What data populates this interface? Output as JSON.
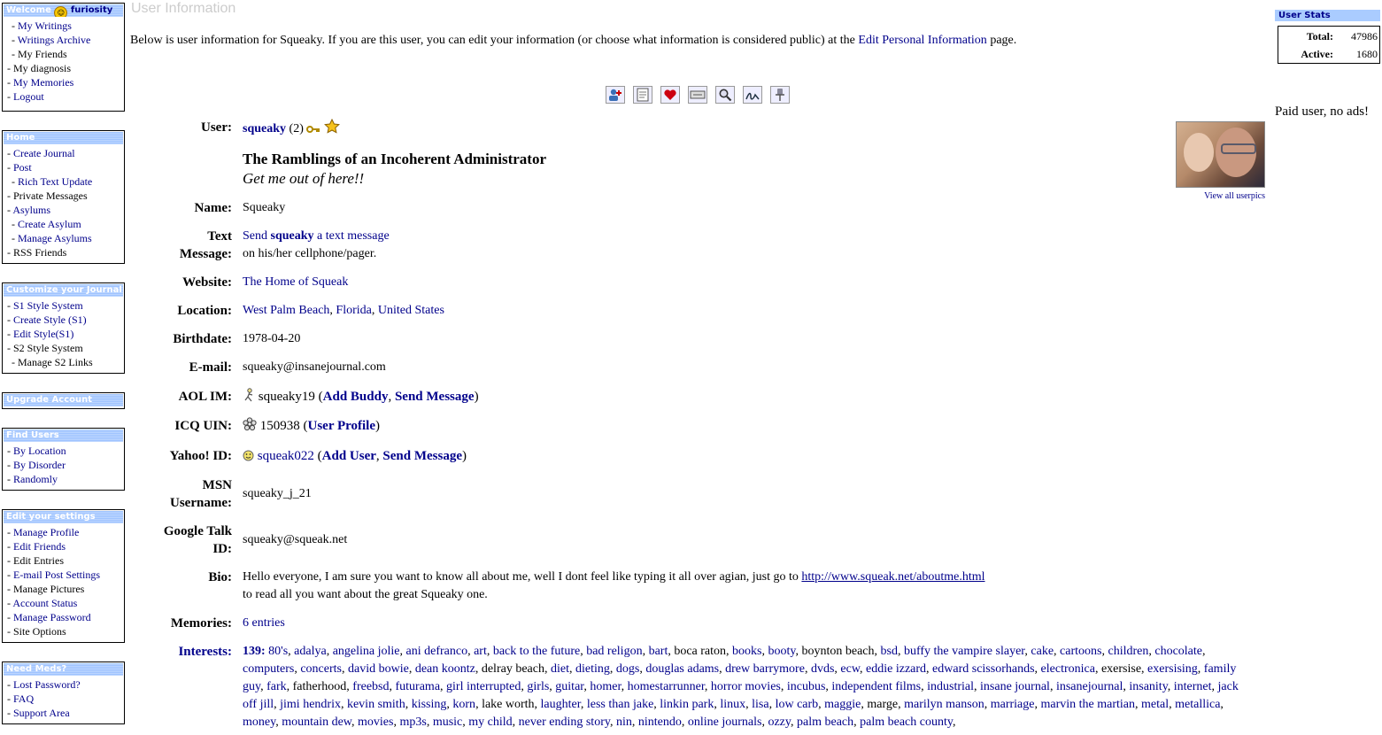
{
  "sidebar": {
    "welcome": {
      "title": "Welcome",
      "username": "furiosity",
      "items": [
        "My Writings",
        "Writings Archive",
        "My Friends",
        "My diagnosis",
        "My Memories",
        "Logout"
      ]
    },
    "home": {
      "title": "Home",
      "items": [
        "Create Journal",
        "Post",
        "Rich Text Update",
        "Private Messages",
        "Asylums",
        "Create Asylum",
        "Manage Asylums",
        "RSS Friends"
      ]
    },
    "customize": {
      "title": "Customize your Journal",
      "items": [
        "S1 Style System",
        "Create Style (S1)",
        "Edit Style(S1)",
        "S2 Style System",
        "Manage S2 Links"
      ]
    },
    "upgrade": {
      "title": "Upgrade Account"
    },
    "find_users": {
      "title": "Find Users",
      "items": [
        "By Location",
        "By Disorder",
        "Randomly"
      ]
    },
    "settings": {
      "title": "Edit your settings",
      "items": [
        "Manage Profile",
        "Edit Friends",
        "Edit Entries",
        "E-mail Post Settings",
        "Manage Pictures",
        "Account Status",
        "Manage Password",
        "Site Options"
      ]
    },
    "need_meds": {
      "title": "Need Meds?",
      "items": [
        "Lost Password?",
        "FAQ",
        "Support Area"
      ]
    }
  },
  "page": {
    "title": "User Information",
    "intro_before": "Below is user information for Squeaky. If you are this user, you can edit your information (or choose what information is considered public) at the ",
    "intro_link": "Edit Personal Information",
    "intro_after": " page."
  },
  "toolbar": [
    "add-friend-icon",
    "memories-icon",
    "heart-icon",
    "tag-icon",
    "search-icon",
    "signature-icon",
    "pushpin-icon"
  ],
  "profile": {
    "user": {
      "label": "User:",
      "username": "squeaky",
      "count": "(2)"
    },
    "journal_title": "The Ramblings of an Incoherent Administrator",
    "journal_subtitle": "Get me out of here!!",
    "name": {
      "label": "Name:",
      "value": "Squeaky"
    },
    "text_message": {
      "label1": "Text",
      "label2": "Message:",
      "link_prefix": "Send ",
      "link_user": "squeaky",
      "link_suffix": " a text message",
      "note": "on his/her cellphone/pager."
    },
    "website": {
      "label": "Website:",
      "value": "The Home of Squeak"
    },
    "location": {
      "label": "Location:",
      "city": "West Palm Beach",
      "state": "Florida",
      "country": "United States"
    },
    "birthdate": {
      "label": "Birthdate:",
      "value": "1978-04-20"
    },
    "email": {
      "label": "E-mail:",
      "value": "squeaky@insanejournal.com"
    },
    "aim": {
      "label": "AOL IM:",
      "value": "squeaky19",
      "add": "Add Buddy",
      "send": "Send Message"
    },
    "icq": {
      "label": "ICQ UIN:",
      "value": "150938",
      "profile": "User Profile"
    },
    "yahoo": {
      "label": "Yahoo! ID:",
      "value": "squeak022",
      "add": "Add User",
      "send": "Send Message"
    },
    "msn": {
      "label1": "MSN",
      "label2": "Username:",
      "value": "squeaky_j_21"
    },
    "gtalk": {
      "label1": "Google Talk",
      "label2": "ID:",
      "value": "squeaky@squeak.net"
    },
    "bio": {
      "label": "Bio:",
      "line1_before": "Hello everyone, I am sure you want to know all about me, well I dont feel like typing it all over agian, just go to ",
      "link": "http://www.squeak.net/aboutme.html",
      "line2": "to read all you want about the great Squeaky one."
    },
    "memories": {
      "label": "Memories:",
      "value": "6 entries"
    },
    "interests": {
      "label": "Interests:",
      "count": "139:",
      "items": [
        {
          "t": "80's",
          "l": 1
        },
        {
          "t": "adalya",
          "l": 1
        },
        {
          "t": "angelina jolie",
          "l": 1
        },
        {
          "t": "ani defranco",
          "l": 1
        },
        {
          "t": "art",
          "l": 1
        },
        {
          "t": "back to the future",
          "l": 1
        },
        {
          "t": "bad religon",
          "l": 1
        },
        {
          "t": "bart",
          "l": 1
        },
        {
          "t": "boca raton",
          "l": 0
        },
        {
          "t": "books",
          "l": 1
        },
        {
          "t": "booty",
          "l": 1
        },
        {
          "t": "boynton beach",
          "l": 0
        },
        {
          "t": "bsd",
          "l": 1
        },
        {
          "t": "buffy the vampire slayer",
          "l": 1
        },
        {
          "t": "cake",
          "l": 1
        },
        {
          "t": "cartoons",
          "l": 1
        },
        {
          "t": "children",
          "l": 1
        },
        {
          "t": "chocolate",
          "l": 1
        },
        {
          "t": "computers",
          "l": 1
        },
        {
          "t": "concerts",
          "l": 1
        },
        {
          "t": "david bowie",
          "l": 1
        },
        {
          "t": "dean koontz",
          "l": 1
        },
        {
          "t": "delray beach",
          "l": 0
        },
        {
          "t": "diet",
          "l": 1
        },
        {
          "t": "dieting",
          "l": 1
        },
        {
          "t": "dogs",
          "l": 1
        },
        {
          "t": "douglas adams",
          "l": 1
        },
        {
          "t": "drew barrymore",
          "l": 1
        },
        {
          "t": "dvds",
          "l": 1
        },
        {
          "t": "ecw",
          "l": 1
        },
        {
          "t": "eddie izzard",
          "l": 1
        },
        {
          "t": "edward scissorhands",
          "l": 1
        },
        {
          "t": "electronica",
          "l": 1
        },
        {
          "t": "exersise",
          "l": 0
        },
        {
          "t": "exersising",
          "l": 1
        },
        {
          "t": "family guy",
          "l": 1
        },
        {
          "t": "fark",
          "l": 1
        },
        {
          "t": "fatherhood",
          "l": 0
        },
        {
          "t": "freebsd",
          "l": 1
        },
        {
          "t": "futurama",
          "l": 1
        },
        {
          "t": "girl interrupted",
          "l": 1
        },
        {
          "t": "girls",
          "l": 1
        },
        {
          "t": "guitar",
          "l": 1
        },
        {
          "t": "homer",
          "l": 1
        },
        {
          "t": "homestarrunner",
          "l": 1
        },
        {
          "t": "horror movies",
          "l": 1
        },
        {
          "t": "incubus",
          "l": 1
        },
        {
          "t": "independent films",
          "l": 1
        },
        {
          "t": "industrial",
          "l": 1
        },
        {
          "t": "insane journal",
          "l": 1
        },
        {
          "t": "insanejournal",
          "l": 1
        },
        {
          "t": "insanity",
          "l": 1
        },
        {
          "t": "internet",
          "l": 1
        },
        {
          "t": "jack off jill",
          "l": 1
        },
        {
          "t": "jimi hendrix",
          "l": 1
        },
        {
          "t": "kevin smith",
          "l": 1
        },
        {
          "t": "kissing",
          "l": 1
        },
        {
          "t": "korn",
          "l": 1
        },
        {
          "t": "lake worth",
          "l": 0
        },
        {
          "t": "laughter",
          "l": 1
        },
        {
          "t": "less than jake",
          "l": 1
        },
        {
          "t": "linkin park",
          "l": 1
        },
        {
          "t": "linux",
          "l": 1
        },
        {
          "t": "lisa",
          "l": 1
        },
        {
          "t": "low carb",
          "l": 1
        },
        {
          "t": "maggie",
          "l": 1
        },
        {
          "t": "marge",
          "l": 0
        },
        {
          "t": "marilyn manson",
          "l": 1
        },
        {
          "t": "marriage",
          "l": 1
        },
        {
          "t": "marvin the martian",
          "l": 1
        },
        {
          "t": "metal",
          "l": 1
        },
        {
          "t": "metallica",
          "l": 1
        },
        {
          "t": "money",
          "l": 1
        },
        {
          "t": "mountain dew",
          "l": 1
        },
        {
          "t": "movies",
          "l": 1
        },
        {
          "t": "mp3s",
          "l": 1
        },
        {
          "t": "music",
          "l": 1
        },
        {
          "t": "my child",
          "l": 1
        },
        {
          "t": "never ending story",
          "l": 1
        },
        {
          "t": "nin",
          "l": 1
        },
        {
          "t": "nintendo",
          "l": 1
        },
        {
          "t": "online journals",
          "l": 1
        },
        {
          "t": "ozzy",
          "l": 1
        },
        {
          "t": "palm beach",
          "l": 1
        },
        {
          "t": "palm beach county",
          "l": 1
        }
      ]
    },
    "view_all_userpics": "View all userpics"
  },
  "user_stats": {
    "title": "User Stats",
    "total_label": "Total:",
    "total_value": "47986",
    "active_label": "Active:",
    "active_value": "1680"
  },
  "paid_notice": "Paid user, no ads!"
}
